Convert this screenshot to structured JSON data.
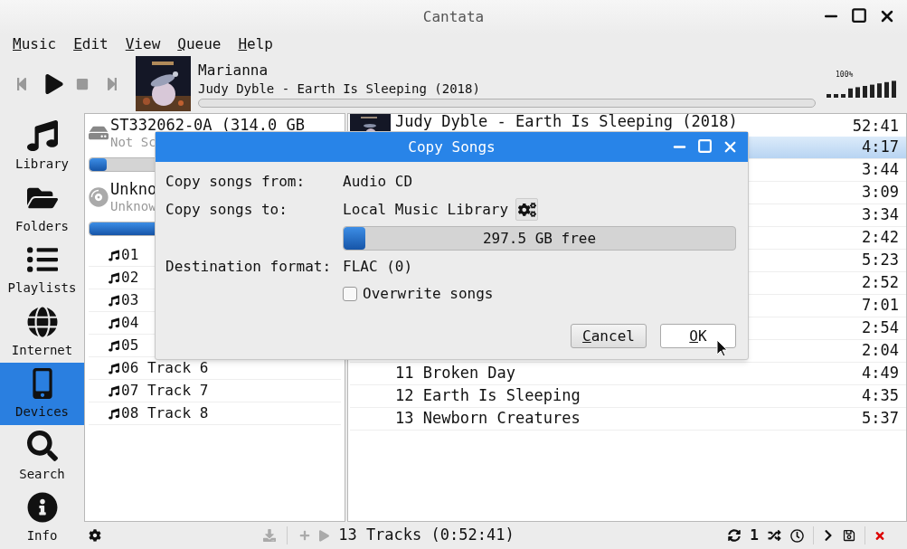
{
  "window": {
    "title": "Cantata"
  },
  "menu": [
    "Music",
    "Edit",
    "View",
    "Queue",
    "Help"
  ],
  "now_playing": {
    "title": "Marianna",
    "subtitle": "Judy Dyble - Earth Is Sleeping (2018)",
    "level": 0,
    "volume": "100%"
  },
  "sidebar": [
    {
      "label": "Library",
      "selected": false
    },
    {
      "label": "Folders",
      "selected": false
    },
    {
      "label": "Playlists",
      "selected": false
    },
    {
      "label": "Internet",
      "selected": false
    },
    {
      "label": "Devices",
      "selected": true
    },
    {
      "label": "Search",
      "selected": false
    },
    {
      "label": "Info",
      "selected": false
    }
  ],
  "devices": [
    {
      "kind": "disk",
      "title": "ST332062-0A (314.0 GB",
      "subtitle": "Not Sc",
      "level": 0.07
    },
    {
      "kind": "cd",
      "title": "Unkno",
      "subtitle": "Unknow",
      "level": 1
    }
  ],
  "device_tracks": [
    "01",
    "02",
    "03",
    "04",
    "05",
    "06 Track 6",
    "07 Track 7",
    "08 Track 8"
  ],
  "playlist": {
    "album": "Judy Dyble - Earth Is Sleeping (2018)",
    "album_duration": "52:41",
    "tracks": [
      {
        "duration": "4:17",
        "selected": true
      },
      {
        "duration": "3:44",
        "selected": false
      },
      {
        "duration": "3:09",
        "selected": false
      },
      {
        "duration": "3:34",
        "selected": false
      },
      {
        "duration": "2:42",
        "selected": false
      },
      {
        "duration": "5:23",
        "selected": false
      },
      {
        "duration": "2:52",
        "selected": false
      },
      {
        "duration": "7:01",
        "selected": false
      },
      {
        "duration": "2:54",
        "selected": false
      },
      {
        "duration": "2:04",
        "selected": false
      },
      {
        "title": "11 Broken Day",
        "duration": "4:49",
        "selected": false
      },
      {
        "title": "12 Earth Is Sleeping",
        "duration": "4:35",
        "selected": false
      },
      {
        "title": "13 Newborn Creatures",
        "duration": "5:37",
        "selected": false
      }
    ]
  },
  "status_bar": {
    "summary": "13 Tracks (0:52:41)",
    "single": "1"
  },
  "dialog": {
    "title": "Copy Songs",
    "from_label": "Copy songs from:",
    "from_value": "Audio CD",
    "to_label": "Copy songs to:",
    "to_value": "Local Music Library",
    "space": {
      "level": 0.055,
      "text": "297.5 GB free"
    },
    "format_label": "Destination format:",
    "format_value": "FLAC (0)",
    "overwrite": {
      "label": "Overwrite songs",
      "checked": false
    },
    "buttons": [
      "Cancel",
      "OK"
    ]
  }
}
